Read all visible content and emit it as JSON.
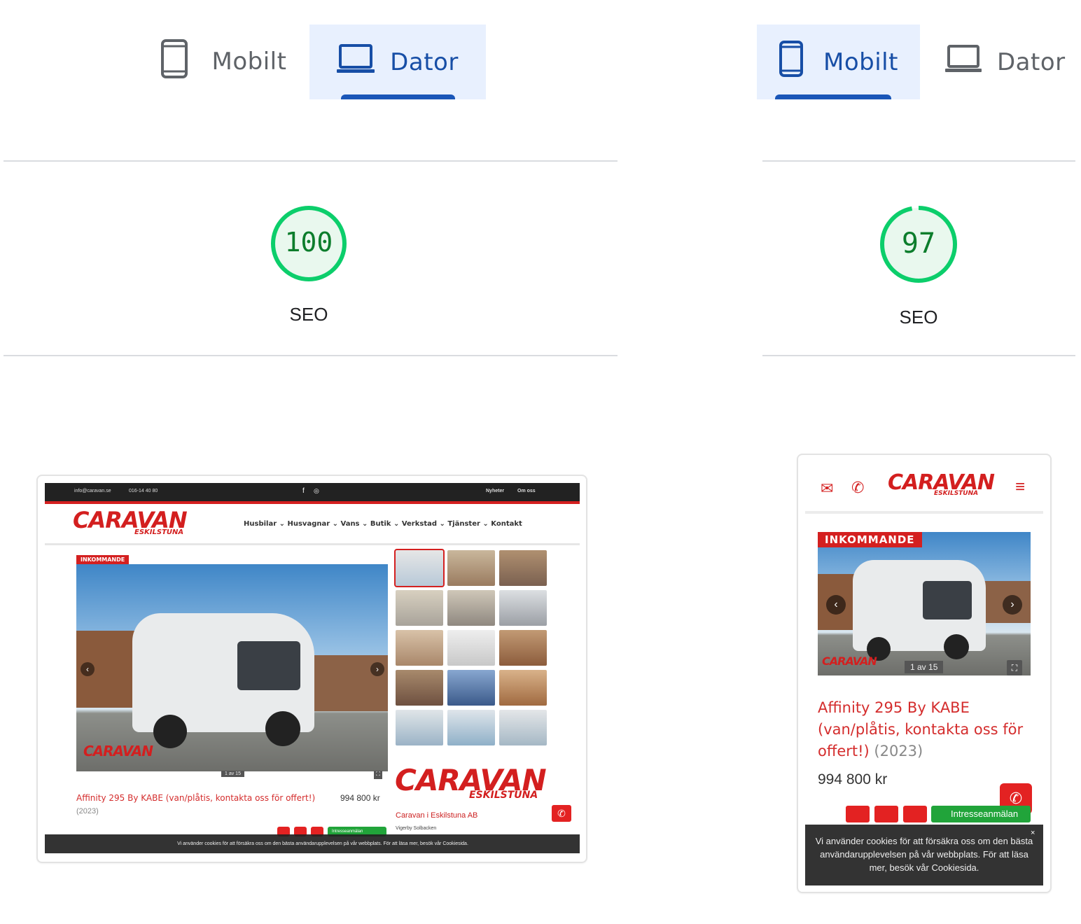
{
  "tabs_left": {
    "mobile": "Mobilt",
    "desktop": "Dator",
    "active": "desktop"
  },
  "tabs_right": {
    "mobile": "Mobilt",
    "desktop": "Dator",
    "active": "mobile"
  },
  "score_left": {
    "value": "100",
    "label": "SEO",
    "fraction": 1.0
  },
  "score_right": {
    "value": "97",
    "label": "SEO",
    "fraction": 0.97
  },
  "colors": {
    "pass_green": "#0cce6b",
    "pass_text": "#0c7d2c",
    "tab_active": "#174ea6",
    "brand_red": "#d42020"
  },
  "desktop_preview": {
    "topbar_email": "info@caravan.se",
    "topbar_phone": "016-14 40 80",
    "topbar_links": [
      "Nyheter",
      "Om oss"
    ],
    "logo_main": "CARAVAN",
    "logo_sub": "ESKILSTUNA",
    "nav": [
      "Husbilar",
      "Husvagnar",
      "Vans",
      "Butik",
      "Verkstad",
      "Tjänster",
      "Kontakt"
    ],
    "badge": "INKOMMANDE",
    "counter": "1 av 15",
    "title": "Affinity 295 By KABE (van/plåtis, kontakta oss för offert!)",
    "year": "(2023)",
    "price": "994 800 kr",
    "company": "Caravan i Eskilstuna AB",
    "address": "Vigerby Solbacken",
    "interest_button": "Intresseanmälan",
    "cookie_text": "Vi använder cookies för att försäkra oss om den bästa användarupplevelsen på vår webbplats. För att läsa mer, besök vår Cookiesida."
  },
  "mobile_preview": {
    "logo_main": "CARAVAN",
    "logo_sub": "ESKILSTUNA",
    "badge": "INKOMMANDE",
    "counter": "1 av 15",
    "title": "Affinity 295 By KABE (van/plåtis, kontakta oss för offert!)",
    "year": "(2023)",
    "price": "994 800 kr",
    "interest_button": "Intresseanmälan",
    "cookie_text": "Vi använder cookies för att försäkra oss om den bästa användarupplevelsen på vår webbplats. För att läsa mer, besök vår Cookiesida."
  }
}
